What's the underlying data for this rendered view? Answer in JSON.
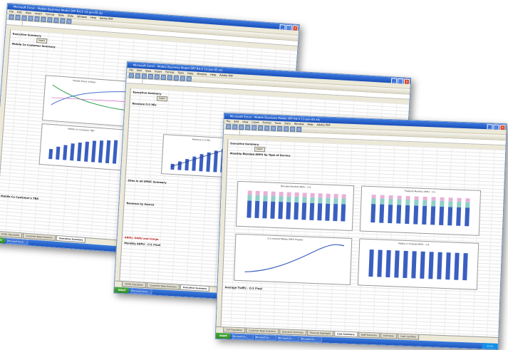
{
  "windows": [
    {
      "title": "Microsoft Excel - Mobile Business Model SPP R4.5 13-Jan-05.xls",
      "menu": [
        "File",
        "Edit",
        "View",
        "Insert",
        "Format",
        "Tools",
        "Data",
        "Window",
        "Help",
        "Adobe PDF"
      ],
      "sheet_heading": "Executive Summary",
      "button": "Insert",
      "sections": [
        "Mobile Co Customer Summary",
        "Mobile Co Customer's TBA"
      ],
      "chart_titles": [
        "Market Share of Base",
        "Mobile Co Customer TBA"
      ],
      "sheet_tabs": [
        "TOTAL Population",
        "Customer Base Evolution",
        "Executive Summary"
      ],
      "task_button": "Microsoft Excel - ..."
    },
    {
      "title": "Microsoft Excel - Mobile Business Model SPP R4.5 13-Jan-05.xls",
      "menu": [
        "File",
        "Edit",
        "View",
        "Insert",
        "Format",
        "Tools",
        "Data",
        "Window",
        "Help",
        "Adobe PDF"
      ],
      "sheet_heading": "Executive Summary",
      "button": "Insert",
      "sections": [
        "Revenue Cr1 Mix",
        "Sites in all SMSC Summary",
        "Revenue by Source",
        "ARPU, OARU and Usage",
        "Monthly ARPU - Cr1 Final"
      ],
      "chart_titles": [
        "Revenue Cr1 Mix"
      ],
      "sheet_tabs": [
        "TOTAL Population",
        "Customer Base Evolution",
        "Executive Summary"
      ],
      "task_button": "Microsoft Excel - ..."
    },
    {
      "title": "Microsoft Excel - Mobile Business Model SPP R4.5 13-Jan-05.xls",
      "menu": [
        "File",
        "Edit",
        "View",
        "Insert",
        "Format",
        "Tools",
        "Data",
        "Window",
        "Help",
        "Adobe PDF"
      ],
      "sheet_heading": "Executive Summary",
      "button": "Insert",
      "sections": [
        "Monthly Blended ARPU by Type of Service",
        "Average Traffic - Cr1 Final"
      ],
      "chart_titles": [
        "Blended Monthly ARPU - Cr1",
        "Postpaid Monthly ARPU - Cr1",
        "Cr1 Interest MBase ARPU Prepaid",
        "Mobile Cr Prepaid ARPU - Cr1"
      ],
      "sheet_tabs": [
        "OCF Population",
        "Customer Base Evolution",
        "Executive Summary",
        "Financial Highlights",
        "Cost Summary",
        "Staff Summary",
        "Estimates",
        "Cash Cashflow"
      ],
      "task_button": "Microsoft Excel - ...",
      "task_items": [
        "Ready",
        "Microsoft Ex...",
        "Microsoft Ex...",
        "Microsoft Ex...",
        "Microsoft Ex..."
      ],
      "clock": "11:41"
    }
  ],
  "start_label": "start",
  "years": [
    "Dec 04",
    "Dec 05",
    "Dec 06",
    "Dec 07",
    "Dec 08",
    "Dec 09",
    "Dec 10",
    "Dec 11",
    "Dec 12",
    "Dec 13",
    "Dec 14",
    "Dec 15",
    "Dec 16"
  ]
}
